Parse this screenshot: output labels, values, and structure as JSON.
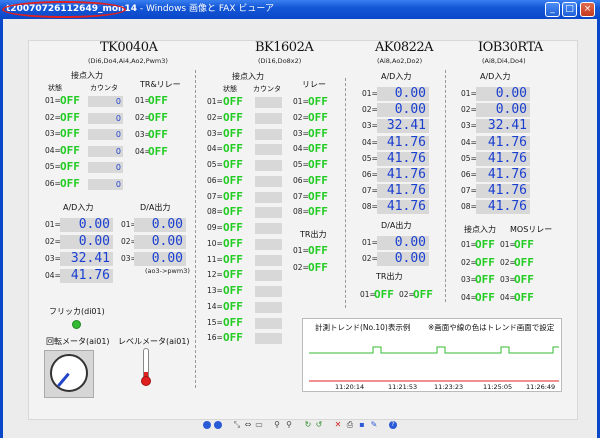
{
  "window": {
    "title_file": "t20070726112649_mon14",
    "title_app": " - Windows 画像と FAX ビューア"
  },
  "tk": {
    "name": "TK0040A",
    "spec": "(Di6,Do4,Ai4,Ao2,Pwm3)",
    "contact_title": "接点入力",
    "state_h": "状態",
    "count_h": "カウンタ",
    "tr_title": "TR&リレー",
    "inputs": [
      {
        "n": "01=",
        "v": "OFF",
        "c": "0"
      },
      {
        "n": "02=",
        "v": "OFF",
        "c": "0"
      },
      {
        "n": "03=",
        "v": "OFF",
        "c": "0"
      },
      {
        "n": "04=",
        "v": "OFF",
        "c": "0"
      },
      {
        "n": "05=",
        "v": "OFF",
        "c": "0"
      },
      {
        "n": "06=",
        "v": "OFF",
        "c": "0"
      }
    ],
    "outputs": [
      {
        "n": "01=",
        "v": "OFF"
      },
      {
        "n": "02=",
        "v": "OFF"
      },
      {
        "n": "03=",
        "v": "OFF"
      },
      {
        "n": "04=",
        "v": "OFF"
      }
    ],
    "ad_title": "A/D入力",
    "da_title": "D/A出力",
    "ad": [
      {
        "n": "01=",
        "v": "0.00"
      },
      {
        "n": "02=",
        "v": "0.00"
      },
      {
        "n": "03=",
        "v": "32.41"
      },
      {
        "n": "04=",
        "v": "41.76"
      }
    ],
    "da": [
      {
        "n": "01=",
        "v": "0.00"
      },
      {
        "n": "02=",
        "v": "0.00"
      },
      {
        "n": "03=",
        "v": "0.00"
      }
    ],
    "da_note": "(ao3->pwm3)",
    "flicker": "フリッカ(di01)",
    "rotary": "回転メータ(ai01)",
    "level": "レベルメータ(ai01)"
  },
  "bk": {
    "name": "BK1602A",
    "spec": "(Di16,Do8x2)",
    "contact_title": "接点入力",
    "state_h": "状態",
    "count_h": "カウンタ",
    "relay_title": "リレー",
    "tr_title": "TR出力",
    "inputs": [
      {
        "n": "01=",
        "v": "OFF"
      },
      {
        "n": "02=",
        "v": "OFF"
      },
      {
        "n": "03=",
        "v": "OFF"
      },
      {
        "n": "04=",
        "v": "OFF"
      },
      {
        "n": "05=",
        "v": "OFF"
      },
      {
        "n": "06=",
        "v": "OFF"
      },
      {
        "n": "07=",
        "v": "OFF"
      },
      {
        "n": "08=",
        "v": "OFF"
      },
      {
        "n": "09=",
        "v": "OFF"
      },
      {
        "n": "10=",
        "v": "OFF"
      },
      {
        "n": "11=",
        "v": "OFF"
      },
      {
        "n": "12=",
        "v": "OFF"
      },
      {
        "n": "13=",
        "v": "OFF"
      },
      {
        "n": "14=",
        "v": "OFF"
      },
      {
        "n": "15=",
        "v": "OFF"
      },
      {
        "n": "16=",
        "v": "OFF"
      }
    ],
    "relays": [
      {
        "n": "01=",
        "v": "OFF"
      },
      {
        "n": "02=",
        "v": "OFF"
      },
      {
        "n": "03=",
        "v": "OFF"
      },
      {
        "n": "04=",
        "v": "OFF"
      },
      {
        "n": "05=",
        "v": "OFF"
      },
      {
        "n": "06=",
        "v": "OFF"
      },
      {
        "n": "07=",
        "v": "OFF"
      },
      {
        "n": "08=",
        "v": "OFF"
      }
    ],
    "tr": [
      {
        "n": "01=",
        "v": "OFF"
      },
      {
        "n": "02=",
        "v": "OFF"
      }
    ]
  },
  "ak": {
    "name": "AK0822A",
    "spec": "(Ai8,Ao2,Do2)",
    "ad_title": "A/D入力",
    "da_title": "D/A出力",
    "tr_title": "TR出力",
    "ad": [
      {
        "n": "01=",
        "v": "0.00"
      },
      {
        "n": "02=",
        "v": "0.00"
      },
      {
        "n": "03=",
        "v": "32.41"
      },
      {
        "n": "04=",
        "v": "41.76"
      },
      {
        "n": "05=",
        "v": "41.76"
      },
      {
        "n": "06=",
        "v": "41.76"
      },
      {
        "n": "07=",
        "v": "41.76"
      },
      {
        "n": "08=",
        "v": "41.76"
      }
    ],
    "da": [
      {
        "n": "01=",
        "v": "0.00"
      },
      {
        "n": "02=",
        "v": "0.00"
      }
    ],
    "tr": [
      {
        "n": "01=",
        "v": "OFF"
      },
      {
        "n": "02=",
        "v": "OFF"
      }
    ]
  },
  "iob": {
    "name": "IOB30RTA",
    "spec": "(Ai8,Di4,Do4)",
    "ad_title": "A/D入力",
    "contact_title": "接点入力",
    "mos_title": "MOSリレー",
    "ad": [
      {
        "n": "01=",
        "v": "0.00"
      },
      {
        "n": "02=",
        "v": "0.00"
      },
      {
        "n": "03=",
        "v": "32.41"
      },
      {
        "n": "04=",
        "v": "41.76"
      },
      {
        "n": "05=",
        "v": "41.76"
      },
      {
        "n": "06=",
        "v": "41.76"
      },
      {
        "n": "07=",
        "v": "41.76"
      },
      {
        "n": "08=",
        "v": "41.76"
      }
    ],
    "inputs": [
      {
        "n": "01=",
        "v": "OFF"
      },
      {
        "n": "02=",
        "v": "OFF"
      },
      {
        "n": "03=",
        "v": "OFF"
      },
      {
        "n": "04=",
        "v": "OFF"
      }
    ],
    "mos": [
      {
        "n": "01=",
        "v": "OFF"
      },
      {
        "n": "02=",
        "v": "OFF"
      },
      {
        "n": "03=",
        "v": "OFF"
      },
      {
        "n": "04=",
        "v": "OFF"
      }
    ]
  },
  "trend": {
    "title": "計測トレンド(No.10)表示例",
    "note": "※画面や線の色はトレンド画面で設定",
    "times": [
      "11:20:14",
      "11:21:53",
      "11:23:23",
      "11:25:05",
      "11:26:49"
    ]
  },
  "colors": {
    "off_green": "#22cc22",
    "value_blue": "#1a3fd0",
    "title_blue": "#0a47c9",
    "trend_red": "#e02020"
  }
}
